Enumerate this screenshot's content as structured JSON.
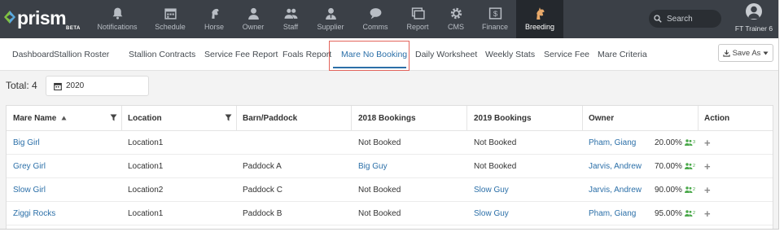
{
  "brand": {
    "name": "prism",
    "tag": "BETA",
    "accent": "#3b4047"
  },
  "nav": {
    "items": [
      {
        "label": "Notifications",
        "icon": "bell-icon"
      },
      {
        "label": "Schedule",
        "icon": "calendar-icon"
      },
      {
        "label": "Horse",
        "icon": "horse-head-icon"
      },
      {
        "label": "Owner",
        "icon": "person-icon"
      },
      {
        "label": "Staff",
        "icon": "people-icon"
      },
      {
        "label": "Supplier",
        "icon": "supplier-icon"
      },
      {
        "label": "Comms",
        "icon": "chat-icon"
      },
      {
        "label": "Report",
        "icon": "report-icon"
      },
      {
        "label": "CMS",
        "icon": "gear-icon"
      },
      {
        "label": "Finance",
        "icon": "money-icon"
      },
      {
        "label": "Breeding",
        "icon": "breeding-horse-icon",
        "active": true
      }
    ],
    "search_placeholder": "Search",
    "user_label": "FT Trainer 6"
  },
  "subnav": {
    "tabs": [
      {
        "label": "Dashboard"
      },
      {
        "label": "Stallion Roster"
      },
      {
        "label": "Stallion Contracts"
      },
      {
        "label": "Service Fee Report"
      },
      {
        "label": "Foals Report"
      },
      {
        "label": "Mare No Booking",
        "active": true
      },
      {
        "label": "Daily Worksheet"
      },
      {
        "label": "Weekly Stats"
      },
      {
        "label": "Service Fee"
      },
      {
        "label": "Mare Criteria"
      }
    ],
    "save_as": "Save As"
  },
  "filters": {
    "total_label": "Total: 4",
    "year": "2020"
  },
  "table": {
    "headers": {
      "mare_name": "Mare Name",
      "location": "Location",
      "barn": "Barn/Paddock",
      "b2018": "2018 Bookings",
      "b2019": "2019 Bookings",
      "owner": "Owner",
      "action": "Action"
    },
    "rows": [
      {
        "mare": "Big Girl",
        "location": "Location1",
        "barn": "",
        "b2018": "Not Booked",
        "b2019": "Not Booked",
        "owner": "Pham, Giang",
        "share": "20.00%",
        "count": "3",
        "action": "+"
      },
      {
        "mare": "Grey Girl",
        "location": "Location1",
        "barn": "Paddock A",
        "b2018": "Big Guy",
        "b2019": "Not Booked",
        "owner": "Jarvis, Andrew",
        "share": "70.00%",
        "count": "2",
        "action": "+"
      },
      {
        "mare": "Slow Girl",
        "location": "Location2",
        "barn": "Paddock C",
        "b2018": "Not Booked",
        "b2019": "Slow Guy",
        "owner": "Jarvis, Andrew",
        "share": "90.00%",
        "count": "2",
        "action": "+"
      },
      {
        "mare": "Ziggi Rocks",
        "location": "Location1",
        "barn": "Paddock B",
        "b2018": "Not Booked",
        "b2019": "Slow Guy",
        "owner": "Pham, Giang",
        "share": "95.00%",
        "count": "2",
        "action": "+"
      }
    ]
  }
}
